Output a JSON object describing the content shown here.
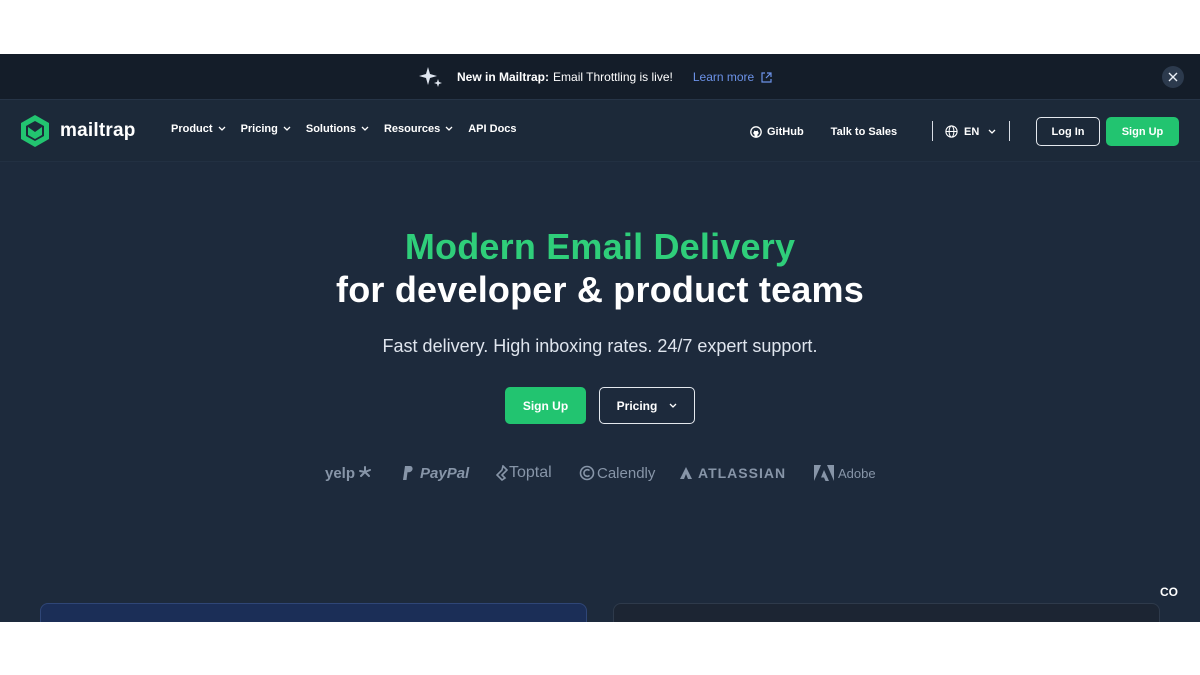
{
  "announcement": {
    "strong": "New in Mailtrap:",
    "text": "Email Throttling is live!",
    "link": "Learn more",
    "icons": [
      "sparkle-icon",
      "external-link-icon",
      "close-icon"
    ]
  },
  "brand": {
    "name": "mailtrap",
    "accent": "#22c470"
  },
  "nav": {
    "menu": [
      "Product",
      "Pricing",
      "Solutions",
      "Resources",
      "API Docs"
    ],
    "github": "GitHub",
    "sales": "Talk to Sales",
    "lang": "EN",
    "login": "Log In",
    "signup": "Sign Up"
  },
  "hero": {
    "line1": "Modern Email Delivery",
    "line2": "for developer & product teams",
    "sub": "Fast delivery. High inboxing rates. 24/7 expert support.",
    "cta_primary": "Sign Up",
    "cta_secondary": "Pricing"
  },
  "logos": [
    "yelp",
    "PayPal",
    "Toptal",
    "Calendly",
    "ATLASSIAN",
    "Adobe"
  ],
  "corner_badge": "CO",
  "colors": {
    "background": "#1d2a3c",
    "green": "#22c470",
    "link": "#6c92e8"
  }
}
